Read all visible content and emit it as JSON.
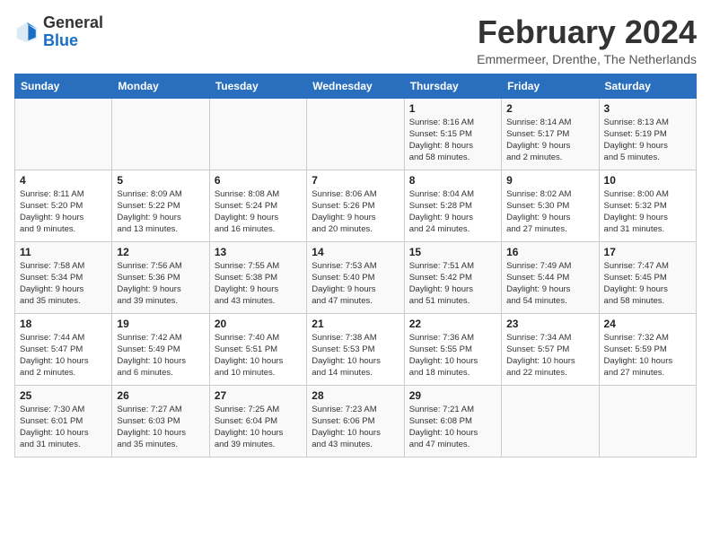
{
  "header": {
    "logo_line1": "General",
    "logo_line2": "Blue",
    "month_year": "February 2024",
    "location": "Emmermeer, Drenthe, The Netherlands"
  },
  "weekdays": [
    "Sunday",
    "Monday",
    "Tuesday",
    "Wednesday",
    "Thursday",
    "Friday",
    "Saturday"
  ],
  "weeks": [
    [
      {
        "day": "",
        "info": ""
      },
      {
        "day": "",
        "info": ""
      },
      {
        "day": "",
        "info": ""
      },
      {
        "day": "",
        "info": ""
      },
      {
        "day": "1",
        "info": "Sunrise: 8:16 AM\nSunset: 5:15 PM\nDaylight: 8 hours\nand 58 minutes."
      },
      {
        "day": "2",
        "info": "Sunrise: 8:14 AM\nSunset: 5:17 PM\nDaylight: 9 hours\nand 2 minutes."
      },
      {
        "day": "3",
        "info": "Sunrise: 8:13 AM\nSunset: 5:19 PM\nDaylight: 9 hours\nand 5 minutes."
      }
    ],
    [
      {
        "day": "4",
        "info": "Sunrise: 8:11 AM\nSunset: 5:20 PM\nDaylight: 9 hours\nand 9 minutes."
      },
      {
        "day": "5",
        "info": "Sunrise: 8:09 AM\nSunset: 5:22 PM\nDaylight: 9 hours\nand 13 minutes."
      },
      {
        "day": "6",
        "info": "Sunrise: 8:08 AM\nSunset: 5:24 PM\nDaylight: 9 hours\nand 16 minutes."
      },
      {
        "day": "7",
        "info": "Sunrise: 8:06 AM\nSunset: 5:26 PM\nDaylight: 9 hours\nand 20 minutes."
      },
      {
        "day": "8",
        "info": "Sunrise: 8:04 AM\nSunset: 5:28 PM\nDaylight: 9 hours\nand 24 minutes."
      },
      {
        "day": "9",
        "info": "Sunrise: 8:02 AM\nSunset: 5:30 PM\nDaylight: 9 hours\nand 27 minutes."
      },
      {
        "day": "10",
        "info": "Sunrise: 8:00 AM\nSunset: 5:32 PM\nDaylight: 9 hours\nand 31 minutes."
      }
    ],
    [
      {
        "day": "11",
        "info": "Sunrise: 7:58 AM\nSunset: 5:34 PM\nDaylight: 9 hours\nand 35 minutes."
      },
      {
        "day": "12",
        "info": "Sunrise: 7:56 AM\nSunset: 5:36 PM\nDaylight: 9 hours\nand 39 minutes."
      },
      {
        "day": "13",
        "info": "Sunrise: 7:55 AM\nSunset: 5:38 PM\nDaylight: 9 hours\nand 43 minutes."
      },
      {
        "day": "14",
        "info": "Sunrise: 7:53 AM\nSunset: 5:40 PM\nDaylight: 9 hours\nand 47 minutes."
      },
      {
        "day": "15",
        "info": "Sunrise: 7:51 AM\nSunset: 5:42 PM\nDaylight: 9 hours\nand 51 minutes."
      },
      {
        "day": "16",
        "info": "Sunrise: 7:49 AM\nSunset: 5:44 PM\nDaylight: 9 hours\nand 54 minutes."
      },
      {
        "day": "17",
        "info": "Sunrise: 7:47 AM\nSunset: 5:45 PM\nDaylight: 9 hours\nand 58 minutes."
      }
    ],
    [
      {
        "day": "18",
        "info": "Sunrise: 7:44 AM\nSunset: 5:47 PM\nDaylight: 10 hours\nand 2 minutes."
      },
      {
        "day": "19",
        "info": "Sunrise: 7:42 AM\nSunset: 5:49 PM\nDaylight: 10 hours\nand 6 minutes."
      },
      {
        "day": "20",
        "info": "Sunrise: 7:40 AM\nSunset: 5:51 PM\nDaylight: 10 hours\nand 10 minutes."
      },
      {
        "day": "21",
        "info": "Sunrise: 7:38 AM\nSunset: 5:53 PM\nDaylight: 10 hours\nand 14 minutes."
      },
      {
        "day": "22",
        "info": "Sunrise: 7:36 AM\nSunset: 5:55 PM\nDaylight: 10 hours\nand 18 minutes."
      },
      {
        "day": "23",
        "info": "Sunrise: 7:34 AM\nSunset: 5:57 PM\nDaylight: 10 hours\nand 22 minutes."
      },
      {
        "day": "24",
        "info": "Sunrise: 7:32 AM\nSunset: 5:59 PM\nDaylight: 10 hours\nand 27 minutes."
      }
    ],
    [
      {
        "day": "25",
        "info": "Sunrise: 7:30 AM\nSunset: 6:01 PM\nDaylight: 10 hours\nand 31 minutes."
      },
      {
        "day": "26",
        "info": "Sunrise: 7:27 AM\nSunset: 6:03 PM\nDaylight: 10 hours\nand 35 minutes."
      },
      {
        "day": "27",
        "info": "Sunrise: 7:25 AM\nSunset: 6:04 PM\nDaylight: 10 hours\nand 39 minutes."
      },
      {
        "day": "28",
        "info": "Sunrise: 7:23 AM\nSunset: 6:06 PM\nDaylight: 10 hours\nand 43 minutes."
      },
      {
        "day": "29",
        "info": "Sunrise: 7:21 AM\nSunset: 6:08 PM\nDaylight: 10 hours\nand 47 minutes."
      },
      {
        "day": "",
        "info": ""
      },
      {
        "day": "",
        "info": ""
      }
    ]
  ]
}
